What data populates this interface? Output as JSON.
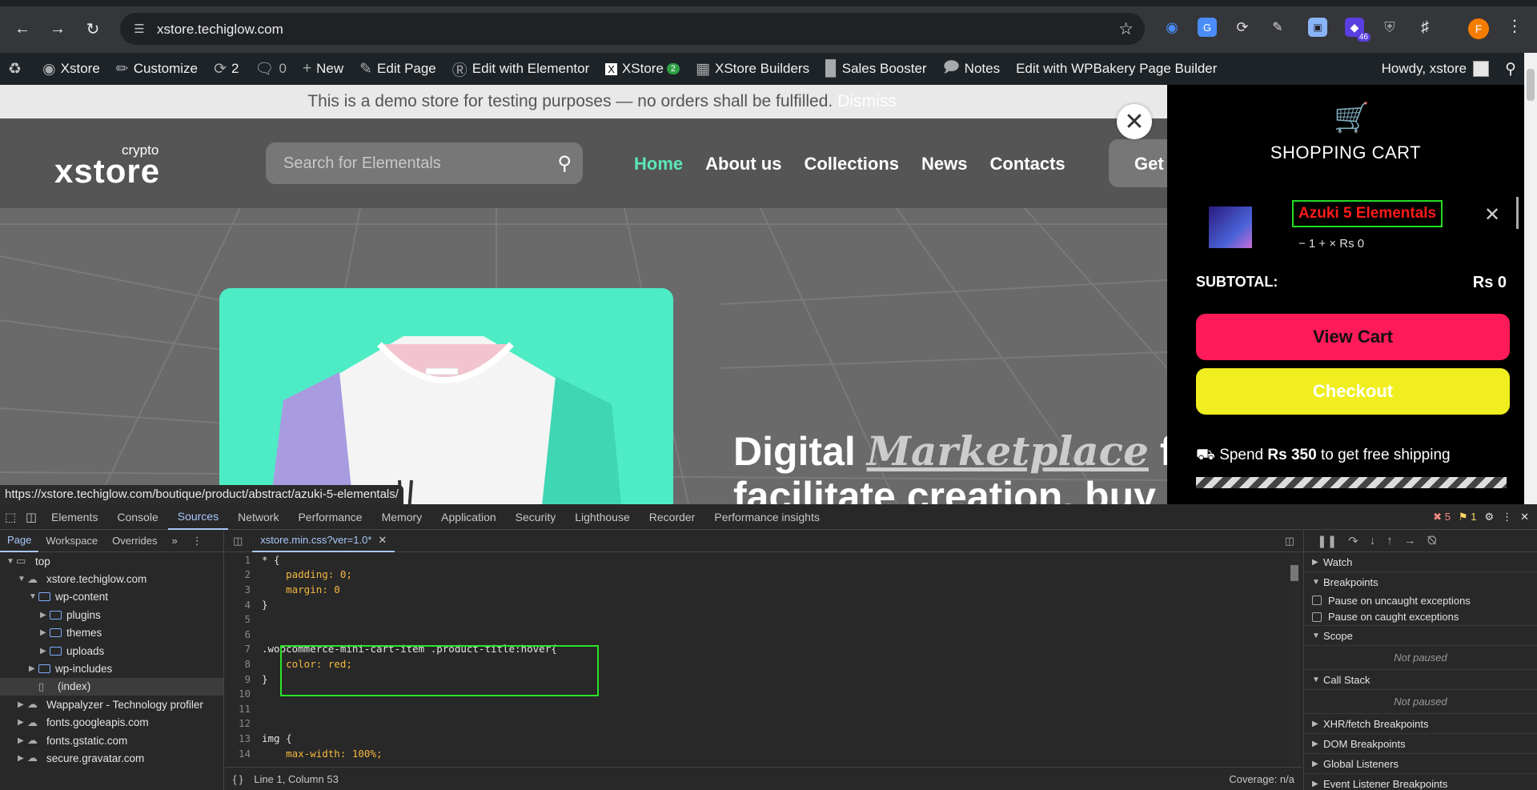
{
  "browser": {
    "url": "xstore.techiglow.com",
    "ext_badge_count": "46",
    "profile_initial": "F"
  },
  "adminbar": {
    "site": "Xstore",
    "customize": "Customize",
    "updates": "2",
    "comments": "0",
    "new": "New",
    "edit_page": "Edit Page",
    "elementor": "Edit with Elementor",
    "xstore": "XStore",
    "xstore_badge": "2",
    "builders": "XStore Builders",
    "booster": "Sales Booster",
    "notes": "Notes",
    "wpbakery": "Edit with WPBakery Page Builder",
    "howdy": "Howdy, xstore"
  },
  "page": {
    "notice": "This is a demo store for testing purposes — no orders shall be fulfilled.",
    "dismiss": "Dismiss",
    "logo_top": "crypto",
    "logo_name": "xstore",
    "search_placeholder": "Search for Elementals",
    "nav": [
      "Home",
      "About us",
      "Collections",
      "News",
      "Contacts"
    ],
    "get_button": "Get",
    "hero_line1_a": "Digital ",
    "hero_line1_b": "Marketplace",
    "hero_line1_c": " for",
    "hero_line2": "facilitate creation, buy",
    "status_url": "https://xstore.techiglow.com/boutique/product/abstract/azuki-5-elementals/"
  },
  "cart": {
    "title": "SHOPPING CART",
    "item_title": "Azuki 5 Elementals",
    "item_qty": "−  1  +   × Rs 0",
    "subtotal_label": "SUBTOTAL:",
    "subtotal_value": "Rs 0",
    "view_cart": "View Cart",
    "checkout": "Checkout",
    "freeship_pre": "Spend ",
    "freeship_amt": "Rs 350",
    "freeship_post": " to get free shipping"
  },
  "devtools": {
    "tabs": [
      "Elements",
      "Console",
      "Sources",
      "Network",
      "Performance",
      "Memory",
      "Application",
      "Security",
      "Lighthouse",
      "Recorder",
      "Performance insights"
    ],
    "active_tab": "Sources",
    "errors": "5",
    "warnings": "1",
    "nav_tabs": [
      "Page",
      "Workspace",
      "Overrides"
    ],
    "tree": [
      {
        "label": "top",
        "depth": 0,
        "kind": "frame",
        "arrow": "▼"
      },
      {
        "label": "xstore.techiglow.com",
        "depth": 1,
        "kind": "cloud",
        "arrow": "▼"
      },
      {
        "label": "wp-content",
        "depth": 2,
        "kind": "folder",
        "arrow": "▼"
      },
      {
        "label": "plugins",
        "depth": 3,
        "kind": "folder",
        "arrow": "▶"
      },
      {
        "label": "themes",
        "depth": 3,
        "kind": "folder",
        "arrow": "▶"
      },
      {
        "label": "uploads",
        "depth": 3,
        "kind": "folder",
        "arrow": "▶"
      },
      {
        "label": "wp-includes",
        "depth": 2,
        "kind": "folder",
        "arrow": "▶"
      },
      {
        "label": "(index)",
        "depth": 2,
        "kind": "file",
        "arrow": ""
      },
      {
        "label": "Wappalyzer - Technology profiler",
        "depth": 1,
        "kind": "cloud",
        "arrow": "▶"
      },
      {
        "label": "fonts.googleapis.com",
        "depth": 1,
        "kind": "cloud",
        "arrow": "▶"
      },
      {
        "label": "fonts.gstatic.com",
        "depth": 1,
        "kind": "cloud",
        "arrow": "▶"
      },
      {
        "label": "secure.gravatar.com",
        "depth": 1,
        "kind": "cloud",
        "arrow": "▶"
      }
    ],
    "file_tab": "xstore.min.css?ver=1.0*",
    "code_lines": [
      {
        "n": "1",
        "t": "* {"
      },
      {
        "n": "2",
        "t": "    padding: 0;"
      },
      {
        "n": "3",
        "t": "    margin: 0"
      },
      {
        "n": "4",
        "t": "}"
      },
      {
        "n": "5",
        "t": ""
      },
      {
        "n": "6",
        "t": ""
      },
      {
        "n": "7",
        "t": ".woocommerce-mini-cart-item .product-title:hover{"
      },
      {
        "n": "8",
        "t": "    color: red;"
      },
      {
        "n": "9",
        "t": "}"
      },
      {
        "n": "10",
        "t": ""
      },
      {
        "n": "11",
        "t": ""
      },
      {
        "n": "12",
        "t": ""
      },
      {
        "n": "13",
        "t": "img {"
      },
      {
        "n": "14",
        "t": "    max-width: 100%;"
      }
    ],
    "status_pos": "Line 1, Column 53",
    "coverage": "Coverage: n/a",
    "sections": {
      "watch": "Watch",
      "breakpoints": "Breakpoints",
      "pause_uncaught": "Pause on uncaught exceptions",
      "pause_caught": "Pause on caught exceptions",
      "scope": "Scope",
      "not_paused": "Not paused",
      "call_stack": "Call Stack",
      "xhr": "XHR/fetch Breakpoints",
      "dom": "DOM Breakpoints",
      "global": "Global Listeners",
      "event": "Event Listener Breakpoints"
    }
  },
  "colors": {
    "accent": "#a8c7fa",
    "nav_active": "#5be6b7",
    "view_cart": "#ff1a5a",
    "checkout": "#f0ee1f",
    "highlight": "#2ae22a"
  }
}
